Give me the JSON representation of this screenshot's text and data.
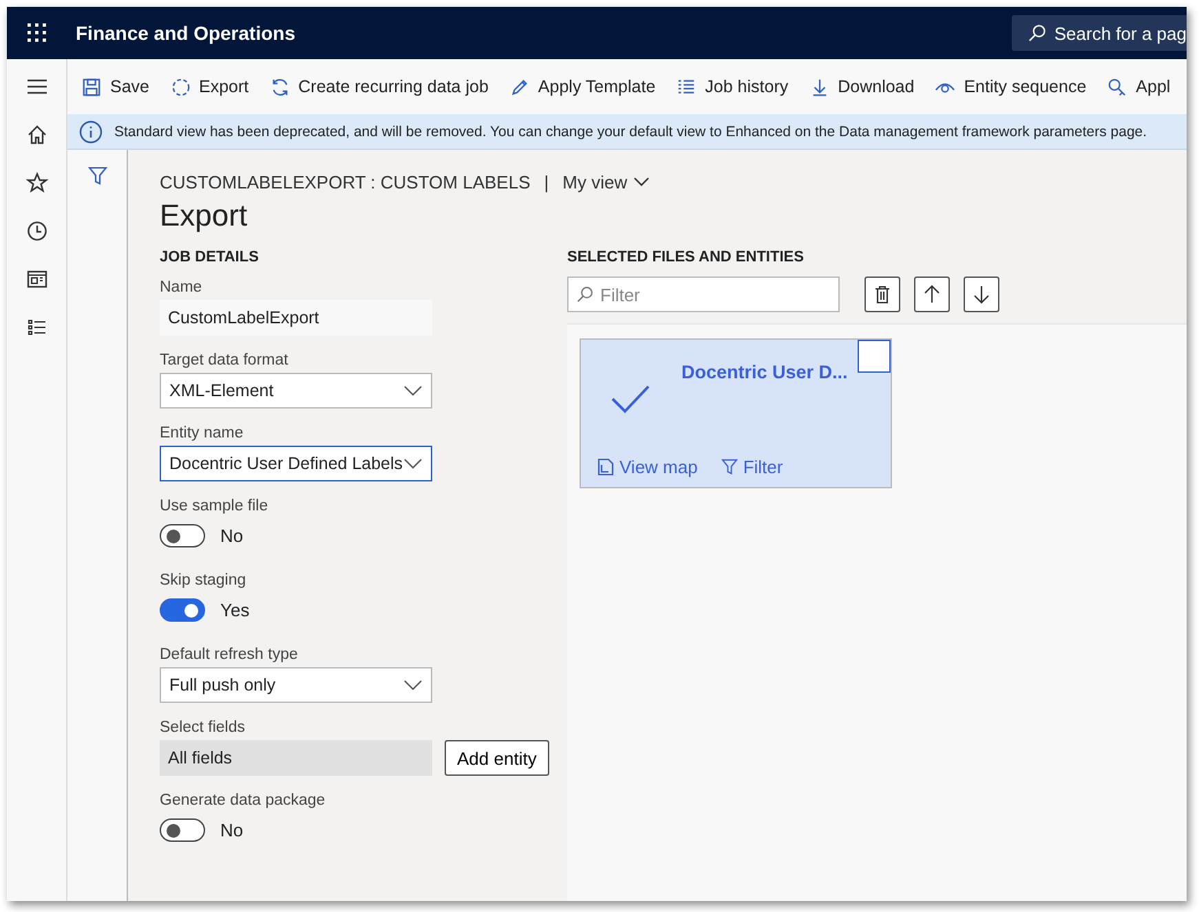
{
  "app_bar": {
    "title": "Finance and Operations",
    "search": {
      "placeholder": "Search for a pag"
    }
  },
  "toolbar": [
    "Save",
    "Export",
    "Create recurring data job",
    "Apply Template",
    "Job history",
    "Download",
    "Entity sequence",
    "Appl"
  ],
  "info_bar": {
    "text": "Standard view has been deprecated, and will be removed. You can change your default view to Enhanced on the Data management framework parameters page."
  },
  "breadcrumb": {
    "path": "CUSTOMLABELEXPORT : CUSTOM LABELS",
    "separator": "|",
    "view": "My view"
  },
  "page_title": "Export",
  "job_details": {
    "heading": "JOB DETAILS",
    "fields": [
      {
        "kind": "text",
        "label": "Name",
        "value": "CustomLabelExport"
      },
      {
        "kind": "select",
        "label": "Target data format",
        "value": "XML-Element",
        "focused": false
      },
      {
        "kind": "select",
        "label": "Entity name",
        "value": "Docentric User Defined Labels",
        "focused": true
      },
      {
        "kind": "toggle",
        "label": "Use sample file",
        "on": false,
        "value": "No"
      },
      {
        "kind": "toggle",
        "label": "Skip staging",
        "on": true,
        "value": "Yes"
      },
      {
        "kind": "select",
        "label": "Default refresh type",
        "value": "Full push only",
        "focused": false
      },
      {
        "kind": "readonly",
        "label": "Select fields",
        "value": "All fields",
        "button": "Add entity"
      },
      {
        "kind": "toggle",
        "label": "Generate data package",
        "on": false,
        "value": "No"
      }
    ]
  },
  "entities": {
    "heading": "SELECTED FILES AND ENTITIES",
    "filter": {
      "placeholder": "Filter"
    },
    "cards": [
      {
        "title": "Docentric User D...",
        "selected": true,
        "links": [
          "View map",
          "Filter"
        ]
      }
    ]
  }
}
